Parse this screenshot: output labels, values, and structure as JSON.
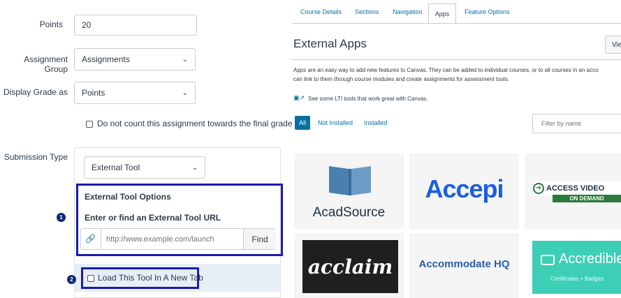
{
  "assignment_form": {
    "points_label": "Points",
    "points_value": "20",
    "assignment_group_label": "Assignment Group",
    "assignment_group_value": "Assignments",
    "display_grade_label": "Display Grade as",
    "display_grade_value": "Points",
    "do_not_count_label": "Do not count this assignment towards the final grade",
    "submission_type_label": "Submission Type",
    "submission_type_value": "External Tool",
    "external_tool_options_title": "External Tool Options",
    "external_tool_url_label": "Enter or find an External Tool URL",
    "url_placeholder": "http://www.example.com/launch",
    "find_button": "Find",
    "load_new_tab_label": "Load This Tool In A New Tab",
    "step_badges": [
      "1",
      "2"
    ]
  },
  "course_settings": {
    "tabs": [
      {
        "label": "Course Details"
      },
      {
        "label": "Sections"
      },
      {
        "label": "Navigation"
      },
      {
        "label": "Apps"
      },
      {
        "label": "Feature Options"
      }
    ],
    "active_tab": "Apps",
    "page_title": "External Apps",
    "view_button": "Vie",
    "description_line1": "Apps are an easy way to add new features to Canvas. They can be added to individual courses, or to all courses in an acco",
    "description_line2": "can link to them through course modules and create assignments for assessment tools.",
    "lti_link": "See some LTI tools that work great with Canvas.",
    "filters": {
      "all": "All",
      "not_installed": "Not Installed",
      "installed": "Installed"
    },
    "filter_placeholder": "Filter by name",
    "apps": [
      {
        "name": "AcadSource",
        "logo": "book-logo"
      },
      {
        "name": "Accepi",
        "logo": "accepi-logo"
      },
      {
        "name": "ACCESS VIDEO",
        "sub": "ON DEMAND",
        "logo": "access-video-logo"
      },
      {
        "name": "acclaim",
        "logo": "acclaim-logo"
      },
      {
        "name": "Accommodate HQ",
        "logo": "accommodate-logo"
      },
      {
        "name": "Accredible",
        "sub": "Certificates + Badges",
        "logo": "accredible-logo"
      }
    ]
  },
  "colors": {
    "frame_blue": "#1a1ab0",
    "badge_navy": "#0b2a77",
    "link_blue": "#0770a3",
    "accepi_blue": "#1a5ee0",
    "accepi_orange": "#f15a24",
    "accredible_teal": "#3ccfb6"
  }
}
